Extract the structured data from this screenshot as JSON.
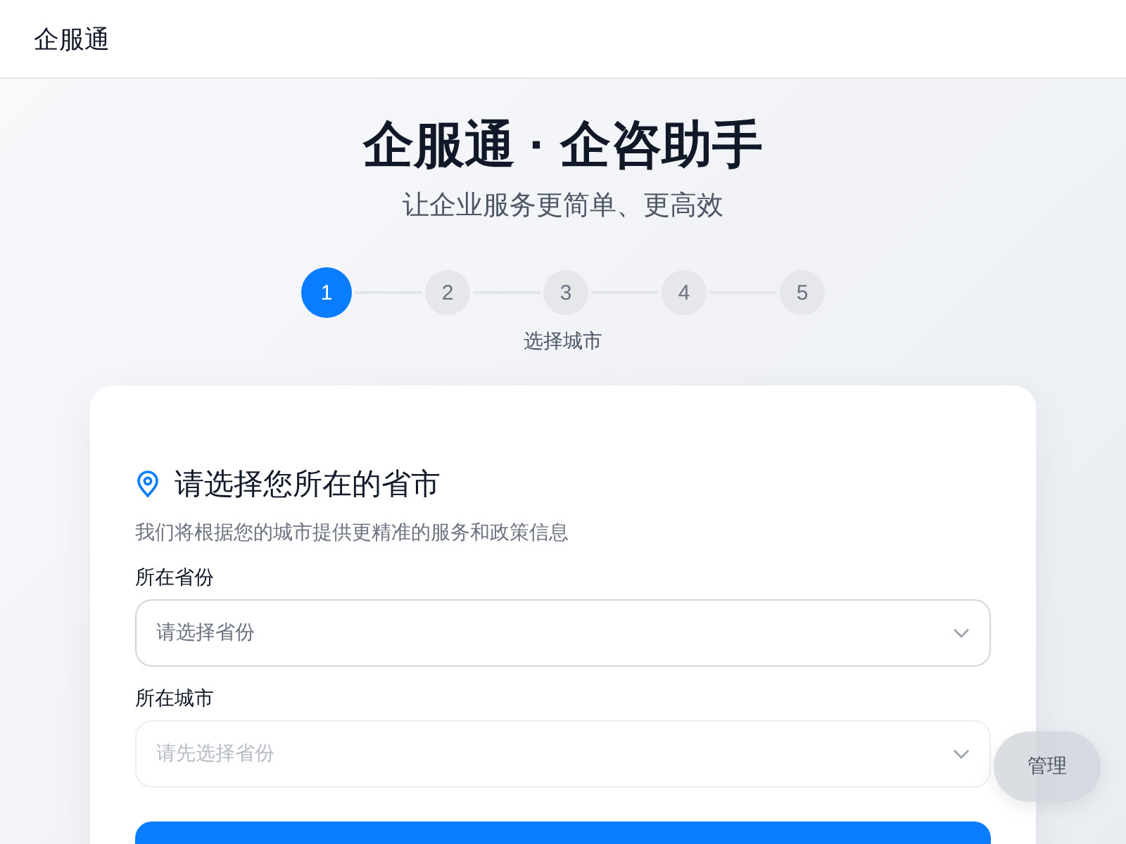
{
  "header": {
    "brand": "企服通"
  },
  "hero": {
    "title": "企服通 · 企咨助手",
    "subtitle": "让企业服务更简单、更高效"
  },
  "steps": [
    {
      "label": "1",
      "selected": true
    },
    {
      "label": "2",
      "selected": false
    },
    {
      "label": "3",
      "selected": false
    },
    {
      "label": "4",
      "selected": false
    },
    {
      "label": "5",
      "selected": false
    }
  ],
  "step_caption": "选择城市",
  "card": {
    "title": "请选择您所在的省市",
    "description": "我们将根据您的城市提供更精准的服务和政策信息",
    "fields": [
      {
        "label": "所在省份",
        "placeholder": "请选择省份",
        "disabled": false
      },
      {
        "label": "所在城市",
        "placeholder": "请先选择省份",
        "disabled": true
      }
    ]
  },
  "floating_button": "管理"
}
